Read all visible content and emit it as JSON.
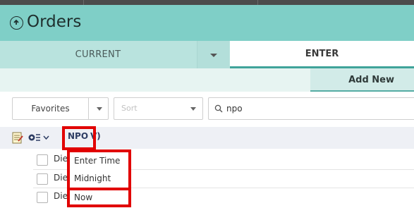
{
  "window": {
    "title": "Orders"
  },
  "tabs": {
    "current_label": "CURRENT",
    "enter_label": "ENTER"
  },
  "toolbar": {
    "add_new_label": "Add New"
  },
  "filters": {
    "favorites_label": "Favorites",
    "sort_placeholder": "Sort",
    "search_value": "npo"
  },
  "list_header": {
    "col_npo": "NPO",
    "col_v": "V)"
  },
  "list": {
    "rows": [
      {
        "text": "Die"
      },
      {
        "text": "Die"
      },
      {
        "text": "Die"
      }
    ]
  },
  "suggestions": [
    "Enter Time",
    "Midnight",
    "Now"
  ],
  "colors": {
    "title_bar": "#7fcfc7",
    "tab_bar": "#b9e3de",
    "accent": "#3fa39a",
    "highlight": "#e10000"
  },
  "icons": {
    "back": "back-circle-icon",
    "notes": "notes-icon",
    "groupby": "group-by-icon",
    "search": "search-icon"
  }
}
